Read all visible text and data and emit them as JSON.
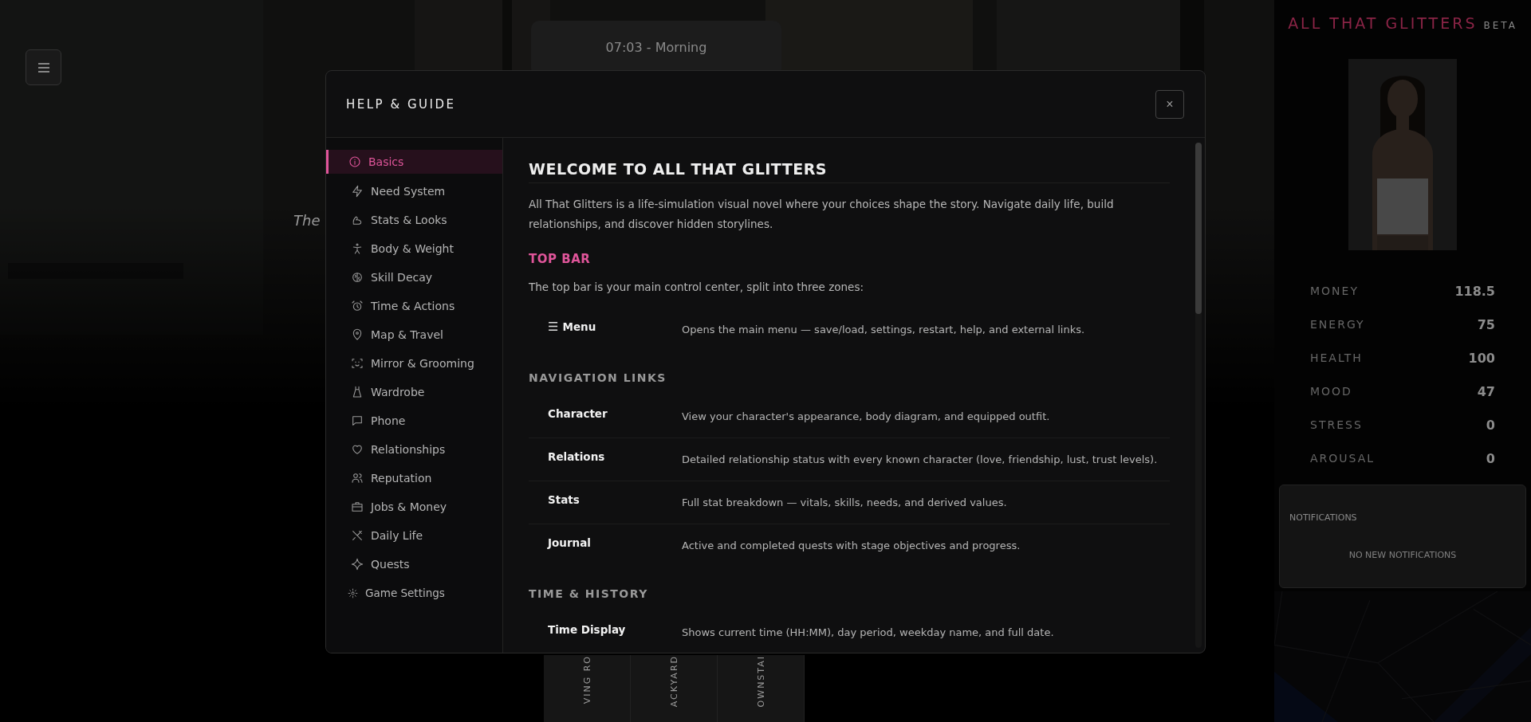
{
  "background": {
    "time": "07:03 - Morning",
    "caption": "The",
    "locations": [
      "VING RO",
      "ACKYARD",
      "OWNSTAI"
    ]
  },
  "side_panel": {
    "title": "ALL THAT GLITTERS",
    "badge": "BETA",
    "stats": [
      {
        "label": "MONEY",
        "value": "118.5"
      },
      {
        "label": "ENERGY",
        "value": "75"
      },
      {
        "label": "HEALTH",
        "value": "100"
      },
      {
        "label": "MOOD",
        "value": "47"
      },
      {
        "label": "STRESS",
        "value": "0"
      },
      {
        "label": "AROUSAL",
        "value": "0"
      }
    ],
    "notifications": {
      "title": "NOTIFICATIONS",
      "empty": "NO NEW NOTIFICATIONS"
    }
  },
  "dialog": {
    "title": "HELP & GUIDE",
    "close": "×",
    "nav": [
      {
        "label": "Basics",
        "selected": true
      },
      {
        "label": "Need System",
        "selected": false
      },
      {
        "label": "Stats & Looks",
        "selected": false
      },
      {
        "label": "Body & Weight",
        "selected": false
      },
      {
        "label": "Skill Decay",
        "selected": false
      },
      {
        "label": "Time & Actions",
        "selected": false
      },
      {
        "label": "Map & Travel",
        "selected": false
      },
      {
        "label": "Mirror & Grooming",
        "selected": false
      },
      {
        "label": "Wardrobe",
        "selected": false
      },
      {
        "label": "Phone",
        "selected": false
      },
      {
        "label": "Relationships",
        "selected": false
      },
      {
        "label": "Reputation",
        "selected": false
      },
      {
        "label": "Jobs & Money",
        "selected": false
      },
      {
        "label": "Daily Life",
        "selected": false
      },
      {
        "label": "Quests",
        "selected": false
      },
      {
        "label": "Game Settings",
        "selected": false
      }
    ],
    "content": {
      "heading": "WELCOME TO ALL THAT GLITTERS",
      "intro": "All That Glitters is a life-simulation visual novel where your choices shape the story. Navigate daily life, build relationships, and discover hidden storylines.",
      "sections": [
        {
          "kind": "accent",
          "title": "TOP BAR",
          "text": "The top bar is your main control center, split into three zones:",
          "rows": [
            {
              "icon": "☰",
              "label": "Menu",
              "text": "Opens the main menu — save/load, settings, restart, help, and external links."
            }
          ]
        },
        {
          "kind": "plain",
          "title": "NAVIGATION LINKS",
          "rows": [
            {
              "label": "Character",
              "text": "View your character's appearance, body diagram, and equipped outfit."
            },
            {
              "label": "Relations",
              "text": "Detailed relationship status with every known character (love, friendship, lust, trust levels)."
            },
            {
              "label": "Stats",
              "text": "Full stat breakdown — vitals, skills, needs, and derived values."
            },
            {
              "label": "Journal",
              "text": "Active and completed quests with stage objectives and progress."
            }
          ]
        },
        {
          "kind": "plain",
          "title": "TIME & HISTORY",
          "rows": [
            {
              "label": "Time Display",
              "text": "Shows current time (HH:MM), day period, weekday name, and full date."
            }
          ]
        }
      ]
    }
  }
}
